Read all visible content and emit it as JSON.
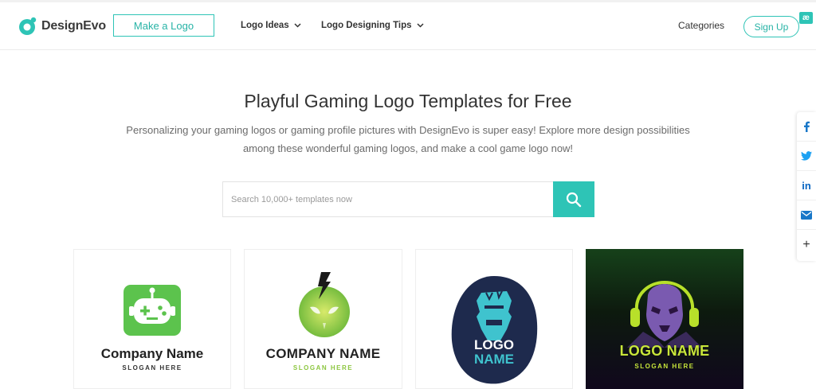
{
  "brand": {
    "name": "DesignEvo",
    "accent": "#2ec4b6"
  },
  "header": {
    "make_logo": "Make a Logo",
    "nav": [
      {
        "label": "Logo Ideas"
      },
      {
        "label": "Logo Designing Tips"
      }
    ],
    "categories": "Categories",
    "sign_up": "Sign Up",
    "badge": "æ"
  },
  "hero": {
    "title": "Playful Gaming Logo Templates for Free",
    "subtitle": "Personalizing your gaming logos or gaming profile pictures with DesignEvo is super easy! Explore more design possibilities among these wonderful gaming logos, and make a cool game logo now!"
  },
  "search": {
    "placeholder": "Search 10,000+ templates now",
    "icon": "search-icon"
  },
  "social": [
    {
      "icon": "facebook-icon",
      "glyph": "f",
      "color": "#1877c8"
    },
    {
      "icon": "twitter-icon",
      "glyph": "t",
      "color": "#1da1f2"
    },
    {
      "icon": "linkedin-icon",
      "glyph": "in",
      "color": "#0a66c2"
    },
    {
      "icon": "email-icon",
      "glyph": "✉",
      "color": "#1877c8"
    },
    {
      "icon": "plus-icon",
      "glyph": "+",
      "color": "#333333"
    }
  ],
  "templates": [
    {
      "name": "Company Name",
      "slogan": "SLOGAN HERE",
      "icon": "game-controller-robot-icon"
    },
    {
      "name": "COMPANY NAME",
      "slogan": "SLOGAN HERE",
      "icon": "alien-lightning-icon"
    },
    {
      "name": "LOGO",
      "name2": "NAME",
      "icon": "gamer-monster-icon"
    },
    {
      "name": "LOGO NAME",
      "slogan": "SLOGAN HERE",
      "icon": "alien-gamer-headset-icon"
    }
  ]
}
